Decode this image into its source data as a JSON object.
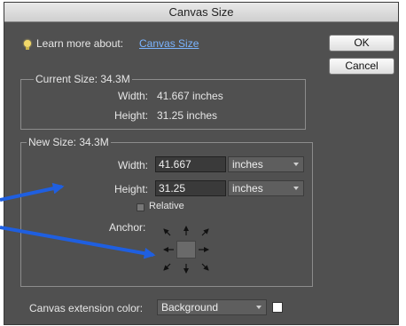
{
  "window": {
    "title": "Canvas Size"
  },
  "info": {
    "learn_more": "Learn more about:",
    "link": "Canvas Size"
  },
  "buttons": {
    "ok": "OK",
    "cancel": "Cancel"
  },
  "current_size": {
    "label": "Current Size: 34.3M",
    "width_label": "Width:",
    "width_value": "41.667 inches",
    "height_label": "Height:",
    "height_value": "31.25 inches"
  },
  "new_size": {
    "label": "New Size: 34.3M",
    "width_label": "Width:",
    "width_value": "41.667",
    "width_unit": "inches",
    "height_label": "Height:",
    "height_value": "31.25",
    "height_unit": "inches",
    "relative_label": "Relative",
    "anchor_label": "Anchor:"
  },
  "extension": {
    "label": "Canvas extension color:",
    "value": "Background",
    "swatch_color": "#ffffff"
  },
  "annotations": {
    "arrow_color": "#1f5fe0"
  }
}
